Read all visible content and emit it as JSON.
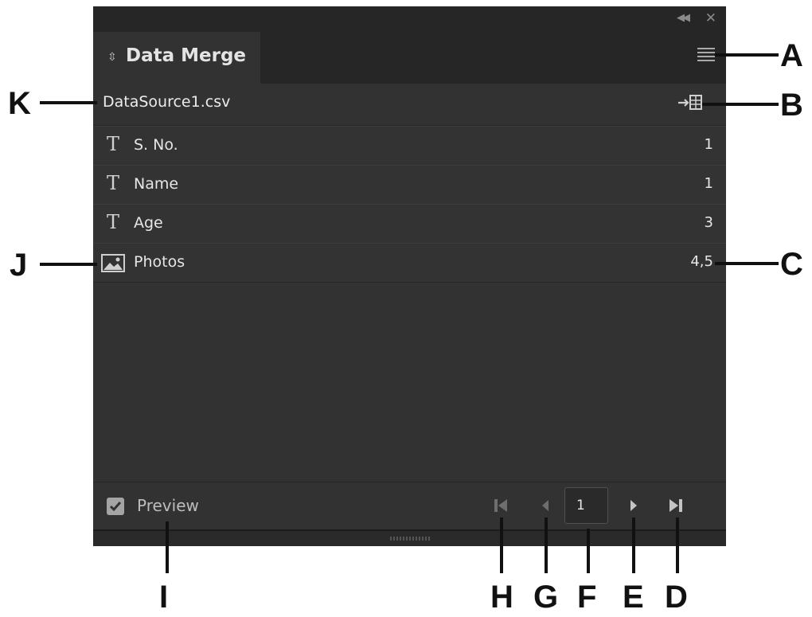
{
  "panel": {
    "title": "Data Merge",
    "data_source": "DataSource1.csv",
    "fields": [
      {
        "name": "S. No.",
        "value": "1",
        "type": "text"
      },
      {
        "name": "Name",
        "value": "1",
        "type": "text"
      },
      {
        "name": "Age",
        "value": "3",
        "type": "text"
      },
      {
        "name": "Photos",
        "value": "4,5",
        "type": "image"
      }
    ],
    "preview_label": "Preview",
    "preview_checked": true,
    "current_record": "1"
  },
  "callouts": {
    "a": "A",
    "b": "B",
    "c": "C",
    "d": "D",
    "e": "E",
    "f": "F",
    "g": "G",
    "h": "H",
    "i": "I",
    "j": "J",
    "k": "K"
  },
  "icons": {
    "title_collapse": "double-chevron-left-icon",
    "title_close": "close-icon",
    "tab": "updown-arrows-icon",
    "menu": "hamburger-menu-icon",
    "import": "import-data-icon",
    "text_field": "text-t-icon",
    "image_field": "image-icon",
    "first": "first-record-icon",
    "prev": "previous-record-icon",
    "next": "next-record-icon",
    "last": "last-record-icon"
  },
  "colors": {
    "panel_bg": "#323232",
    "titlebar_bg": "#262626",
    "text": "#e6e6e6",
    "callout": "#111111"
  }
}
